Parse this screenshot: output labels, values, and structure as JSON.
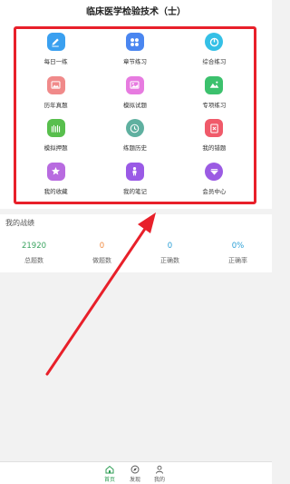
{
  "header": {
    "title": "临床医学检验技术（士）"
  },
  "grid": {
    "items": [
      {
        "label": "每日一练",
        "icon": "pencil-icon",
        "color": "#3aa0f0"
      },
      {
        "label": "章节练习",
        "icon": "grid-icon",
        "color": "#4a86f0"
      },
      {
        "label": "综合练习",
        "icon": "power-icon",
        "color": "#34c0e6"
      },
      {
        "label": "历年真题",
        "icon": "image-icon",
        "color": "#f08a8a"
      },
      {
        "label": "模拟试题",
        "icon": "picture-icon",
        "color": "#e77be0"
      },
      {
        "label": "专项练习",
        "icon": "landscape-icon",
        "color": "#3cc16d"
      },
      {
        "label": "模拟押题",
        "icon": "forest-icon",
        "color": "#58bf4d"
      },
      {
        "label": "练题历史",
        "icon": "clock-icon",
        "color": "#5fb0a0"
      },
      {
        "label": "我的错题",
        "icon": "wrong-list-icon",
        "color": "#f05a6a"
      },
      {
        "label": "我的收藏",
        "icon": "star-icon",
        "color": "#b86be0"
      },
      {
        "label": "我的笔记",
        "icon": "person-note-icon",
        "color": "#9a5ae6"
      },
      {
        "label": "会员中心",
        "icon": "diamond-icon",
        "color": "#9b5be3"
      }
    ]
  },
  "stats": {
    "title": "我的战绩",
    "items": [
      {
        "value": "21920",
        "label": "总题数",
        "color": "#3aa460"
      },
      {
        "value": "0",
        "label": "做题数",
        "color": "#f08a40"
      },
      {
        "value": "0",
        "label": "正确数",
        "color": "#2a9fd6"
      },
      {
        "value": "0%",
        "label": "正确率",
        "color": "#2a9fd6"
      }
    ]
  },
  "tabbar": {
    "items": [
      {
        "label": "首页",
        "icon": "home-icon",
        "active": true
      },
      {
        "label": "发现",
        "icon": "compass-icon",
        "active": false
      },
      {
        "label": "我的",
        "icon": "user-icon",
        "active": false
      }
    ],
    "active_color": "#2f9e55"
  }
}
